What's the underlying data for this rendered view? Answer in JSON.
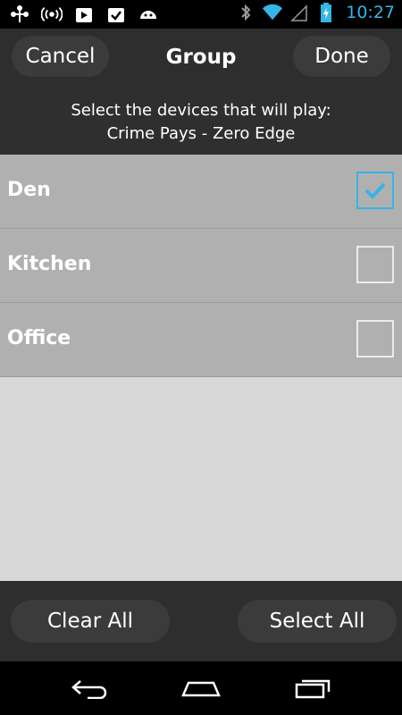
{
  "status_bar": {
    "time": "10:27",
    "icons_left": [
      "usb-icon",
      "radio-icon",
      "play-store-icon",
      "task-icon",
      "android-icon"
    ],
    "icons_right": [
      "bluetooth-icon",
      "wifi-icon",
      "signal-icon",
      "battery-charging-icon"
    ]
  },
  "header": {
    "cancel_label": "Cancel",
    "title": "Group",
    "done_label": "Done"
  },
  "prompt": {
    "line1": "Select the devices that will play:",
    "line2": "Crime Pays - Zero Edge"
  },
  "devices": [
    {
      "label": "Den",
      "checked": true
    },
    {
      "label": "Kitchen",
      "checked": false
    },
    {
      "label": "Office",
      "checked": false
    }
  ],
  "bottom_bar": {
    "clear_label": "Clear All",
    "select_label": "Select All"
  },
  "colors": {
    "accent": "#33b5e5",
    "list_row": "#b0b0b0",
    "bar": "#2e2e2e"
  }
}
